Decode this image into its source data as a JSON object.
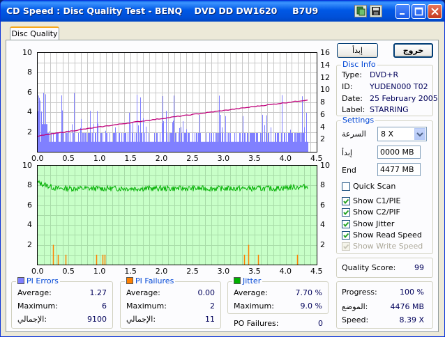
{
  "window": {
    "title": "CD Speed : Disc Quality Test - BENQ    DVD DD DW1620     B7U9"
  },
  "tabs": {
    "disc_quality": "Disc Quality"
  },
  "buttons": {
    "start": "إبدأ",
    "exit": "خروج"
  },
  "disc_info": {
    "title": "Disc Info",
    "type_label": "Type:",
    "type_value": "DVD+R",
    "id_label": "ID:",
    "id_value": "YUDEN000 T02",
    "date_label": "Date:",
    "date_value": "25 February 2005",
    "label_label": "Label:",
    "label_value": "STARRING"
  },
  "settings": {
    "title": "Settings",
    "speed_label": "السرعة",
    "speed_value": "8 X",
    "start_label": "إبدأ",
    "start_value": "0000 MB",
    "end_label": "End",
    "end_value": "4477 MB",
    "quick_scan": "Quick Scan",
    "show_c1": "Show C1/PIE",
    "show_c2": "Show C2/PIF",
    "show_jitter": "Show Jitter",
    "show_read_speed": "Show Read Speed",
    "show_write_speed": "Show Write Speed",
    "checked": {
      "quick_scan": false,
      "show_c1": true,
      "show_c2": true,
      "show_jitter": true,
      "show_read_speed": true,
      "show_write_speed": true
    }
  },
  "quality": {
    "label": "Quality Score:",
    "value": "99"
  },
  "progress": {
    "progress_label": "Progress:",
    "progress_value": "100 %",
    "position_label": "الموضع:",
    "position_value": "4476 MB",
    "speed_label": "Speed:",
    "speed_value": "8.39 X"
  },
  "stats": {
    "pi_errors": {
      "title": "PI Errors",
      "average_label": "Average:",
      "average": "1.27",
      "maximum_label": "Maximum:",
      "maximum": "6",
      "total_label": "الإجمالي:",
      "total": "9100"
    },
    "pi_failures": {
      "title": "PI Failures",
      "average_label": "Average:",
      "average": "0.00",
      "maximum_label": "Maximum:",
      "maximum": "2",
      "total_label": "الإجمالي:",
      "total": "11"
    },
    "jitter": {
      "title": "Jitter",
      "average_label": "Average:",
      "average": "7.70 %",
      "maximum_label": "Maximum:",
      "maximum": "9.0 %"
    },
    "po_failures": {
      "label": "PO Failures:",
      "value": "0"
    }
  },
  "colors": {
    "pi_errors": "#8080ff",
    "pi_failures": "#ff8000",
    "jitter": "#00b000",
    "read_speed": "#c0007a",
    "top_bg": "#ffffff",
    "bottom_bg": "#c8ffc8"
  },
  "chart_data": [
    {
      "type": "bar",
      "name": "PI Errors / Read Speed",
      "x_range": [
        0,
        4.5
      ],
      "xticks": [
        "0.0",
        "0.5",
        "1.0",
        "1.5",
        "2.0",
        "2.5",
        "3.0",
        "3.5",
        "4.0",
        "4.5"
      ],
      "ylim_left": [
        0,
        10
      ],
      "yticks_left": [
        "2",
        "4",
        "6",
        "8",
        "10"
      ],
      "ylim_right": [
        0,
        16
      ],
      "yticks_right": [
        "2",
        "4",
        "6",
        "8",
        "10",
        "12",
        "14",
        "16"
      ],
      "pi_errors": {
        "typical": 1,
        "band_max": 2,
        "peak": 6
      },
      "read_speed": {
        "start": 2.5,
        "end": 8.4
      }
    },
    {
      "type": "line",
      "name": "Jitter / PI Failures",
      "x_range": [
        0,
        4.5
      ],
      "xticks": [
        "0.0",
        "0.5",
        "1.0",
        "1.5",
        "2.0",
        "2.5",
        "3.0",
        "3.5",
        "4.0",
        "4.5"
      ],
      "ylim": [
        0,
        10
      ],
      "yticks": [
        "2",
        "4",
        "6",
        "8",
        "10"
      ],
      "jitter": {
        "start": 8.3,
        "typical": 7.7,
        "end": 7.9
      },
      "pi_failures": [
        [
          0.25,
          2
        ],
        [
          0.33,
          1
        ],
        [
          0.45,
          1
        ],
        [
          0.95,
          1
        ],
        [
          1.05,
          1
        ],
        [
          1.08,
          1
        ],
        [
          3.33,
          1
        ],
        [
          3.4,
          2
        ],
        [
          3.55,
          1
        ],
        [
          4.18,
          1
        ]
      ]
    }
  ]
}
